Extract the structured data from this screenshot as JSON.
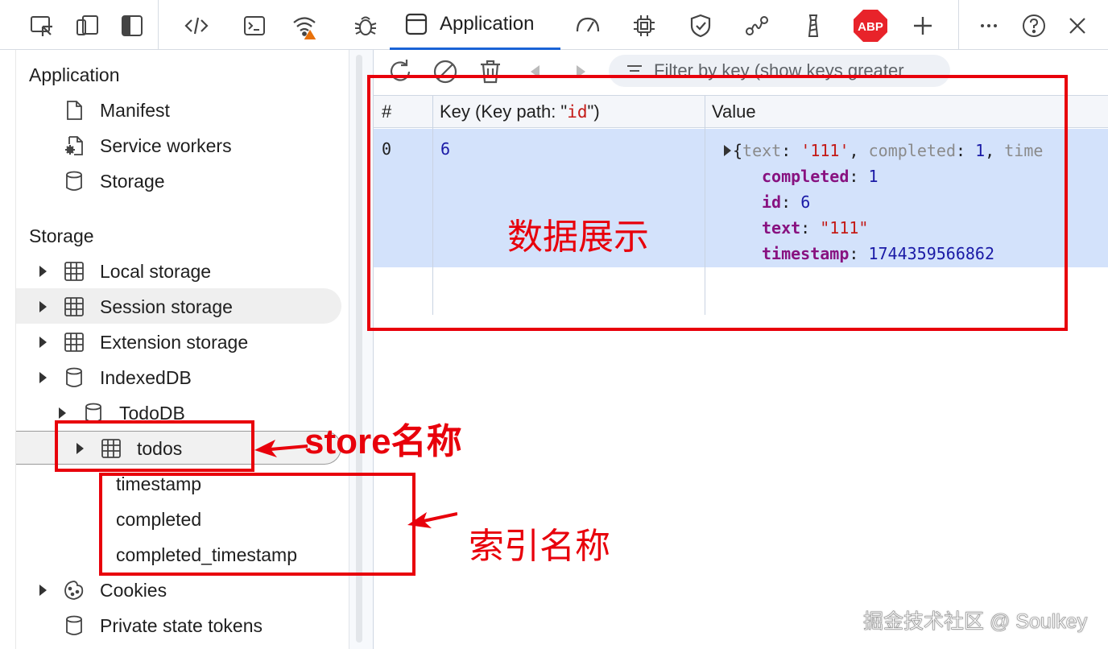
{
  "toolbar": {
    "active_tab": "Application",
    "icons": [
      "inspect-icon",
      "device-toolbar-icon",
      "sidebar-toggle-icon",
      "elements-icon",
      "console-icon",
      "network-warning-icon",
      "sources-bug-icon",
      "application-icon",
      "performance-icon",
      "memory-chip-icon",
      "security-shield-icon",
      "node-graph-icon",
      "lighthouse-icon",
      "adblock-icon",
      "add-icon",
      "more-icon",
      "help-icon",
      "close-icon"
    ],
    "abp_label": "ABP"
  },
  "sidebar": {
    "application_title": "Application",
    "application_items": [
      "Manifest",
      "Service workers",
      "Storage"
    ],
    "storage_title": "Storage",
    "storage_items": [
      "Local storage",
      "Session storage",
      "Extension storage",
      "IndexedDB"
    ],
    "db_name": "TodoDB",
    "store_name": "todos",
    "indexes": [
      "timestamp",
      "completed",
      "completed_timestamp"
    ],
    "bottom_items": [
      "Cookies",
      "Private state tokens"
    ]
  },
  "main": {
    "filter_placeholder": "Filter by key (show keys greater",
    "columns": {
      "index": "#",
      "key_prefix": "Key (Key path: \"",
      "key_path": "id",
      "key_suffix": "\")",
      "value": "Value"
    },
    "row": {
      "index": "0",
      "key": "6",
      "preview_open": "{",
      "preview_text_key": "text",
      "preview_text_val": "'111'",
      "preview_completed_key": "completed",
      "preview_completed_val": "1",
      "preview_more": "time",
      "fields": [
        {
          "key": "completed",
          "value": "1",
          "kind": "num"
        },
        {
          "key": "id",
          "value": "6",
          "kind": "num"
        },
        {
          "key": "text",
          "value": "\"111\"",
          "kind": "str"
        },
        {
          "key": "timestamp",
          "value": "1744359566862",
          "kind": "num"
        }
      ]
    }
  },
  "annotations": {
    "data_label": "数据展示",
    "store_label": "store名称",
    "index_label": "索引名称",
    "color": "#e8000b"
  },
  "watermark": "掘金技术社区 @ Soulkey",
  "colors": {
    "accent": "#1a63d6",
    "row_selected": "#d3e2fb",
    "annotation": "#e8000b"
  }
}
